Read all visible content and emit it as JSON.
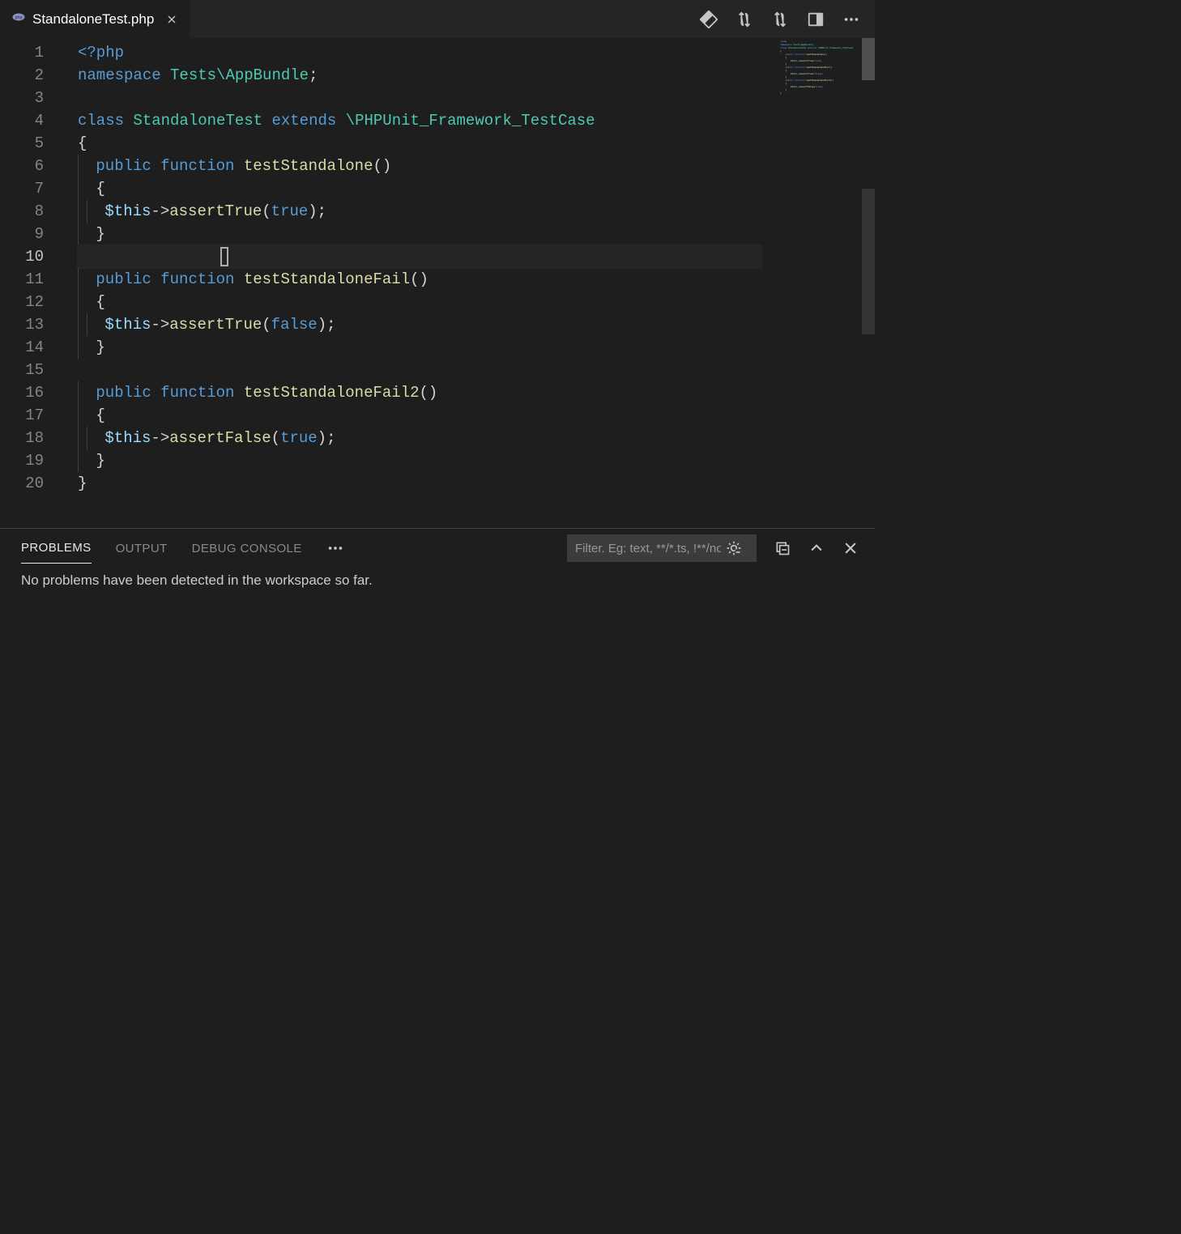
{
  "tab": {
    "filename": "StandaloneTest.php"
  },
  "panel": {
    "tabs": {
      "problems": "PROBLEMS",
      "output": "OUTPUT",
      "debug": "DEBUG CONSOLE"
    },
    "filter_placeholder": "Filter. Eg: text, **/*.ts, !**/node_modules/**",
    "message": "No problems have been detected in the workspace so far."
  },
  "editor": {
    "line_count": 20,
    "current_line": 10,
    "lines": [
      {
        "n": 1,
        "tokens": [
          {
            "t": "<?php",
            "c": "c-key"
          }
        ]
      },
      {
        "n": 2,
        "tokens": [
          {
            "t": "namespace",
            "c": "c-key"
          },
          {
            "t": " ",
            "c": "c-white"
          },
          {
            "t": "Tests\\AppBundle",
            "c": "c-type"
          },
          {
            "t": ";",
            "c": "c-punct"
          }
        ]
      },
      {
        "n": 3,
        "tokens": []
      },
      {
        "n": 4,
        "tokens": [
          {
            "t": "class",
            "c": "c-key"
          },
          {
            "t": " ",
            "c": "c-white"
          },
          {
            "t": "StandaloneTest",
            "c": "c-type"
          },
          {
            "t": " ",
            "c": "c-white"
          },
          {
            "t": "extends",
            "c": "c-key"
          },
          {
            "t": " ",
            "c": "c-white"
          },
          {
            "t": "\\PHPUnit_Framework_TestCase",
            "c": "c-type"
          }
        ]
      },
      {
        "n": 5,
        "tokens": [
          {
            "t": "{",
            "c": "c-punct"
          }
        ]
      },
      {
        "n": 6,
        "indent": 1,
        "tokens": [
          {
            "t": "public",
            "c": "c-key"
          },
          {
            "t": " ",
            "c": "c-white"
          },
          {
            "t": "function",
            "c": "c-func-key"
          },
          {
            "t": " ",
            "c": "c-white"
          },
          {
            "t": "testStandalone",
            "c": "c-fn"
          },
          {
            "t": "()",
            "c": "c-punct"
          }
        ]
      },
      {
        "n": 7,
        "indent": 1,
        "tokens": [
          {
            "t": "{",
            "c": "c-punct"
          }
        ]
      },
      {
        "n": 8,
        "indent": 2,
        "tokens": [
          {
            "t": "$this",
            "c": "c-var"
          },
          {
            "t": "->",
            "c": "c-punct"
          },
          {
            "t": "assertTrue",
            "c": "c-fn"
          },
          {
            "t": "(",
            "c": "c-punct"
          },
          {
            "t": "true",
            "c": "c-const"
          },
          {
            "t": ");",
            "c": "c-punct"
          }
        ]
      },
      {
        "n": 9,
        "indent": 1,
        "tokens": [
          {
            "t": "}",
            "c": "c-punct"
          }
        ]
      },
      {
        "n": 10,
        "indent": 0,
        "current": true,
        "cursor_col": 16,
        "tokens": []
      },
      {
        "n": 11,
        "indent": 1,
        "tokens": [
          {
            "t": "public",
            "c": "c-key"
          },
          {
            "t": " ",
            "c": "c-white"
          },
          {
            "t": "function",
            "c": "c-func-key"
          },
          {
            "t": " ",
            "c": "c-white"
          },
          {
            "t": "testStandaloneFail",
            "c": "c-fn"
          },
          {
            "t": "()",
            "c": "c-punct"
          }
        ]
      },
      {
        "n": 12,
        "indent": 1,
        "tokens": [
          {
            "t": "{",
            "c": "c-punct"
          }
        ]
      },
      {
        "n": 13,
        "indent": 2,
        "tokens": [
          {
            "t": "$this",
            "c": "c-var"
          },
          {
            "t": "->",
            "c": "c-punct"
          },
          {
            "t": "assertTrue",
            "c": "c-fn"
          },
          {
            "t": "(",
            "c": "c-punct"
          },
          {
            "t": "false",
            "c": "c-const"
          },
          {
            "t": ");",
            "c": "c-punct"
          }
        ]
      },
      {
        "n": 14,
        "indent": 1,
        "tokens": [
          {
            "t": "}",
            "c": "c-punct"
          }
        ]
      },
      {
        "n": 15,
        "tokens": []
      },
      {
        "n": 16,
        "indent": 1,
        "tokens": [
          {
            "t": "public",
            "c": "c-key"
          },
          {
            "t": " ",
            "c": "c-white"
          },
          {
            "t": "function",
            "c": "c-func-key"
          },
          {
            "t": " ",
            "c": "c-white"
          },
          {
            "t": "testStandaloneFail2",
            "c": "c-fn"
          },
          {
            "t": "()",
            "c": "c-punct"
          }
        ]
      },
      {
        "n": 17,
        "indent": 1,
        "tokens": [
          {
            "t": "{",
            "c": "c-punct"
          }
        ]
      },
      {
        "n": 18,
        "indent": 2,
        "tokens": [
          {
            "t": "$this",
            "c": "c-var"
          },
          {
            "t": "->",
            "c": "c-punct"
          },
          {
            "t": "assertFalse",
            "c": "c-fn"
          },
          {
            "t": "(",
            "c": "c-punct"
          },
          {
            "t": "true",
            "c": "c-const"
          },
          {
            "t": ");",
            "c": "c-punct"
          }
        ]
      },
      {
        "n": 19,
        "indent": 1,
        "tokens": [
          {
            "t": "}",
            "c": "c-punct"
          }
        ]
      },
      {
        "n": 20,
        "tokens": [
          {
            "t": "}",
            "c": "c-punct"
          }
        ]
      }
    ]
  }
}
